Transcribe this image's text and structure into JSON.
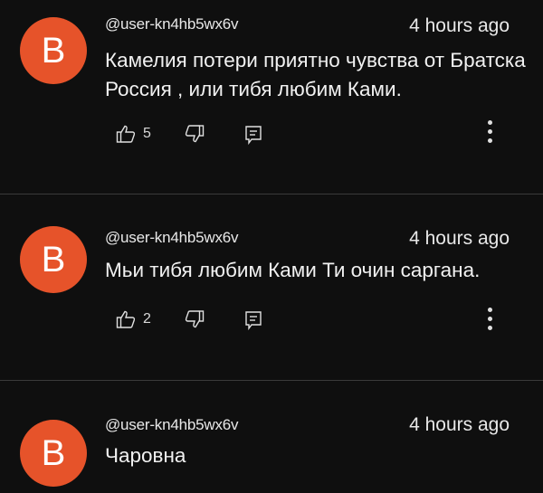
{
  "comments": [
    {
      "avatar_letter": "B",
      "author": "@user-kn4hb5wx6v",
      "time": "4 hours ago",
      "text": "Камелия потери приятно чувства от Братска Россия , или тибя любим Ками.",
      "like_count": "5",
      "icons": [
        "thumb-up-icon",
        "thumb-down-icon",
        "reply-icon",
        "more-vert-icon"
      ]
    },
    {
      "avatar_letter": "B",
      "author": "@user-kn4hb5wx6v",
      "time": "4 hours ago",
      "text": "Мьи тибя любим Ками Ти очин саргана.",
      "like_count": "2",
      "icons": [
        "thumb-up-icon",
        "thumb-down-icon",
        "reply-icon",
        "more-vert-icon"
      ]
    },
    {
      "avatar_letter": "B",
      "author": "@user-kn4hb5wx6v",
      "time": "4 hours ago",
      "text": "Чаровна"
    }
  ],
  "colors": {
    "background": "#0f0f0f",
    "avatar": "#e6532a",
    "divider": "#3a3a3a",
    "text": "#f1f1f1"
  }
}
